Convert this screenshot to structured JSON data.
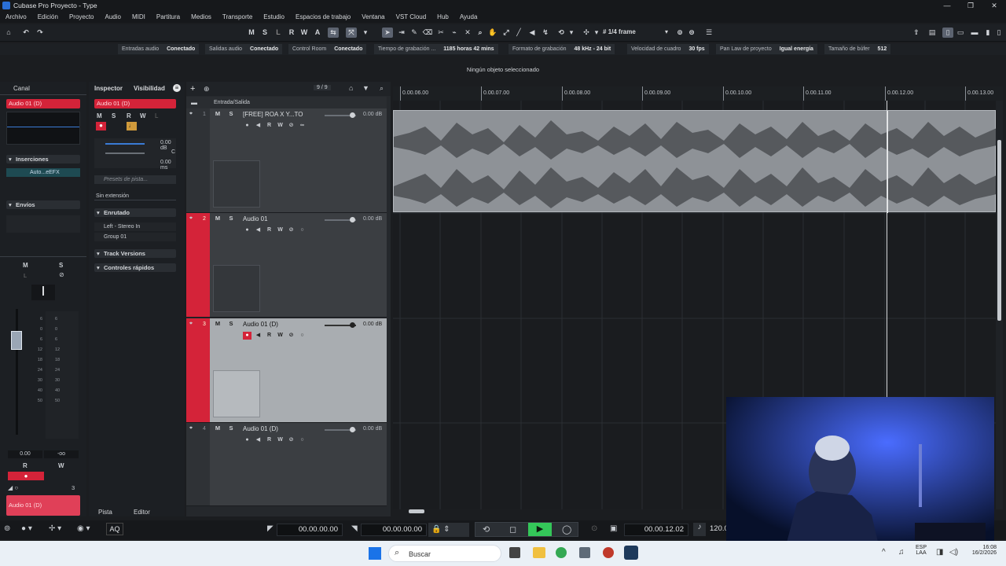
{
  "window": {
    "title": "Cubase Pro Proyecto - Type"
  },
  "menu": [
    "Archivo",
    "Edición",
    "Proyecto",
    "Audio",
    "MIDI",
    "Partitura",
    "Medios",
    "Transporte",
    "Estudio",
    "Espacios de trabajo",
    "Ventana",
    "VST Cloud",
    "Hub",
    "Ayuda"
  ],
  "toolbar": {
    "m": "M",
    "s": "S",
    "l": "L",
    "r": "R",
    "w": "W",
    "a": "A",
    "quantize": "1/4 frame"
  },
  "status": [
    {
      "label": "Entradas audio",
      "value": "Conectado"
    },
    {
      "label": "Salidas audio",
      "value": "Conectado"
    },
    {
      "label": "Control Room",
      "value": "Conectado"
    },
    {
      "label": "Tiempo de grabación ...",
      "value": "1185 horas 42 mins"
    },
    {
      "label": "Formato de grabación",
      "value": "48 kHz - 24 bit"
    },
    {
      "label": "Velocidad de cuadro",
      "value": "30 fps"
    },
    {
      "label": "Pan Law de proyecto",
      "value": "Igual energía"
    },
    {
      "label": "Tamaño de búfer",
      "value": "512"
    }
  ],
  "info": "Ningún objeto seleccionado",
  "left": {
    "tab": "Canal",
    "track": "Audio 01 (D)",
    "inserts": "Inserciones",
    "insert_slot": "Auto...eEFX",
    "sends": "Envíos",
    "m": "M",
    "s": "S",
    "l": "L",
    "vol": "0.00",
    "pan": "-oo",
    "r": "R",
    "w": "W",
    "count": "3",
    "bottom_name": "Audio 01 (D)",
    "scale": [
      "6",
      "0",
      "6",
      "12",
      "18",
      "24",
      "30",
      "40",
      "50"
    ],
    "scale2": [
      "6",
      "0",
      "6",
      "12",
      "18",
      "24",
      "30",
      "40",
      "50"
    ]
  },
  "inspector": {
    "tab1": "Inspector",
    "tab2": "Visibilidad",
    "track": "Audio 01 (D)",
    "m": "M",
    "s": "S",
    "r": "R",
    "w": "W",
    "l": "L",
    "vol": "0.00 dB",
    "pan": "C",
    "delay": "0.00 ms",
    "presets": "Presets de pista...",
    "ext": "Sin extensión",
    "routing": "Enrutado",
    "in": "Left - Stereo In",
    "group": "Group 01",
    "versions": "Track Versions",
    "quick": "Controles rápidos"
  },
  "tracklist": {
    "counter": "9 / 9",
    "folder": "Entrada/Salida",
    "tabs": [
      "Pista",
      "Editor"
    ],
    "tracks": [
      {
        "num": "1",
        "name": "[FREE] ROA X Y...TO",
        "db": "0.00 dB"
      },
      {
        "num": "2",
        "name": "Audio 01",
        "db": "0.00 dB"
      },
      {
        "num": "3",
        "name": "Audio 01 (D)",
        "db": "0.00 dB"
      },
      {
        "num": "4",
        "name": "Audio 01 (D)",
        "db": "0.00 dB"
      }
    ]
  },
  "ruler": [
    "0.00.06.00",
    "0.00.07.00",
    "0.00.08.00",
    "0.00.09.00",
    "0.00.10.00",
    "0.00.11.00",
    "0.00.12.00",
    "0.00.13.00"
  ],
  "transport": {
    "aq": "AQ",
    "left": "00.00.00.00",
    "right": "00.00.00.00",
    "pos": "00.00.12.02",
    "tempo": "120.0"
  },
  "taskbar": {
    "search": "Buscar",
    "lang": "ESP",
    "lang2": "LAA",
    "time": "16:08",
    "date": "16/2/2026"
  }
}
